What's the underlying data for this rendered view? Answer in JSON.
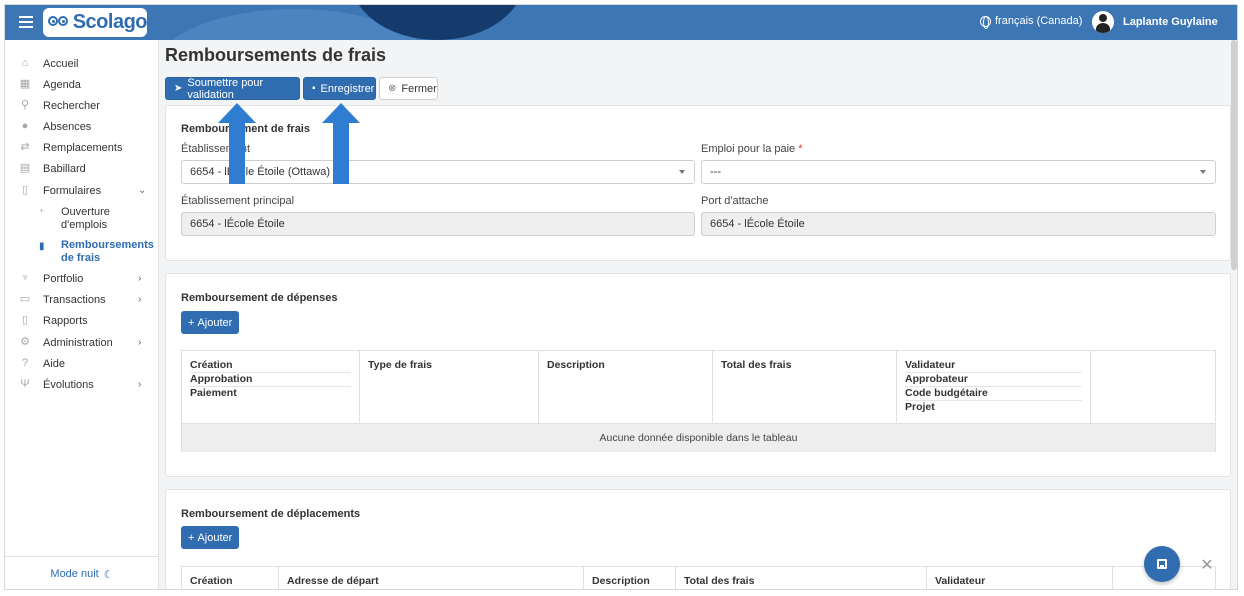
{
  "header": {
    "logo_text": "Scolago",
    "language": "français (Canada)",
    "user_name": "Laplante Guylaine"
  },
  "sidebar": {
    "items": [
      {
        "label": "Accueil",
        "icon": "home-icon"
      },
      {
        "label": "Agenda",
        "icon": "calendar-icon"
      },
      {
        "label": "Rechercher",
        "icon": "search-icon"
      },
      {
        "label": "Absences",
        "icon": "user-absence-icon"
      },
      {
        "label": "Remplacements",
        "icon": "replacement-icon"
      },
      {
        "label": "Babillard",
        "icon": "board-icon"
      },
      {
        "label": "Formulaires",
        "icon": "form-icon"
      },
      {
        "label": "Portfolio",
        "icon": "trophy-icon"
      },
      {
        "label": "Transactions",
        "icon": "transactions-icon"
      },
      {
        "label": "Rapports",
        "icon": "report-icon"
      },
      {
        "label": "Administration",
        "icon": "gear-icon"
      },
      {
        "label": "Aide",
        "icon": "help-icon"
      },
      {
        "label": "Évolutions",
        "icon": "evolution-icon"
      }
    ],
    "sub_items": [
      {
        "label": "Ouverture d'emplois",
        "icon": "add-user-icon"
      },
      {
        "label": "Remboursements de frais",
        "icon": "document-icon"
      }
    ],
    "mode_nuit": "Mode nuit"
  },
  "page": {
    "title": "Remboursements de frais",
    "buttons": {
      "submit": "Soumettre pour validation",
      "save": "Enregistrer",
      "close": "Fermer"
    }
  },
  "section1": {
    "title": "Remboursement de frais",
    "etablissement_label": "Établissement",
    "etablissement_value": "6654 - lÉcole Étoile (Ottawa)",
    "emploi_label": "Emploi pour la paie",
    "emploi_required": "*",
    "emploi_value": "---",
    "principal_label": "Établissement principal",
    "principal_value": "6654 - lÉcole Étoile",
    "attache_label": "Port d'attache",
    "attache_value": "6654 - lÉcole Étoile"
  },
  "section2": {
    "title": "Remboursement de dépenses",
    "add": "Ajouter",
    "columns": {
      "c1": [
        "Création",
        "Approbation",
        "Paiement"
      ],
      "c2": "Type de frais",
      "c3": "Description",
      "c4": "Total des frais",
      "c5": [
        "Validateur",
        "Approbateur",
        "Code budgétaire",
        "Projet"
      ]
    },
    "empty": "Aucune donnée disponible dans le tableau"
  },
  "section3": {
    "title": "Remboursement de déplacements",
    "add": "Ajouter",
    "columns": [
      "Création",
      "Adresse de départ",
      "Description",
      "Total des frais",
      "Validateur"
    ]
  }
}
